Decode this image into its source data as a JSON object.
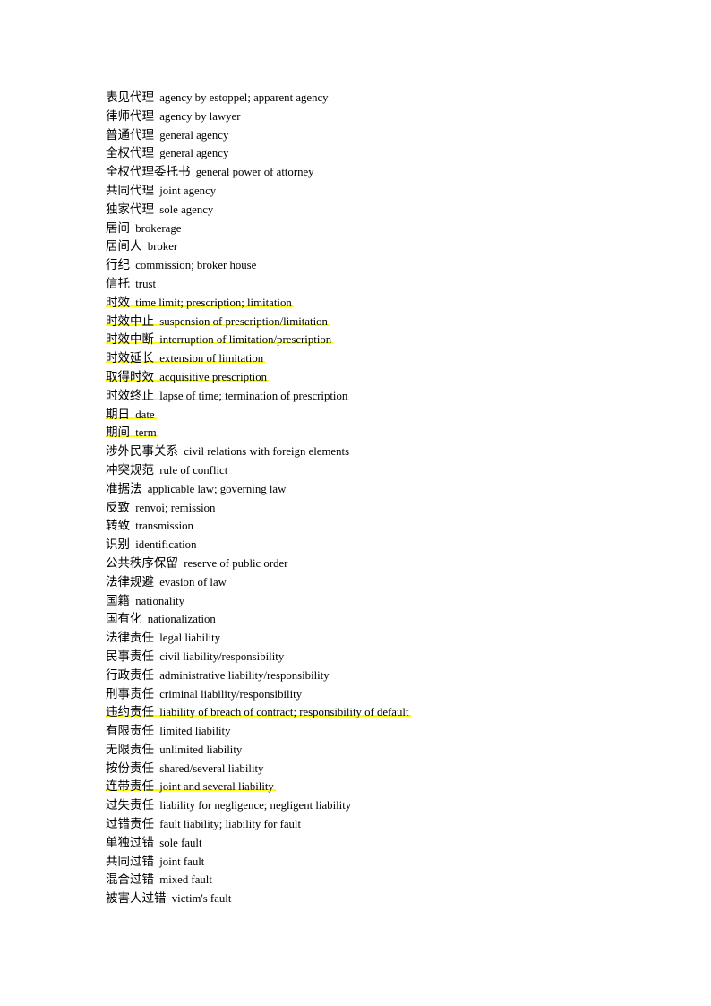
{
  "document": {
    "background_color": "#ffffff",
    "text_color": "#000000",
    "highlight_color": "#ffff00",
    "entries": [
      {
        "term": "表见代理",
        "definition": "agency by estoppel; apparent agency",
        "highlighted": false
      },
      {
        "term": "律师代理",
        "definition": "agency by lawyer",
        "highlighted": false
      },
      {
        "term": "普通代理",
        "definition": "general agency",
        "highlighted": false
      },
      {
        "term": "全权代理",
        "definition": "general agency",
        "highlighted": false
      },
      {
        "term": "全权代理委托书",
        "definition": "general power of attorney",
        "highlighted": false
      },
      {
        "term": "共同代理",
        "definition": "joint agency",
        "highlighted": false
      },
      {
        "term": "独家代理",
        "definition": "sole agency",
        "highlighted": false
      },
      {
        "term": "居间",
        "definition": "brokerage",
        "highlighted": false
      },
      {
        "term": "居间人",
        "definition": "broker",
        "highlighted": false
      },
      {
        "term": "行纪",
        "definition": "commission; broker house",
        "highlighted": false
      },
      {
        "term": "信托",
        "definition": "trust",
        "highlighted": false
      },
      {
        "term": "时效",
        "definition": "time limit; prescription; limitation",
        "highlighted": true
      },
      {
        "term": "时效中止",
        "definition": "suspension of prescription/limitation",
        "highlighted": true
      },
      {
        "term": "时效中断",
        "definition": "interruption of limitation/prescription",
        "highlighted": true
      },
      {
        "term": "时效延长",
        "definition": "extension of limitation",
        "highlighted": true
      },
      {
        "term": "取得时效",
        "definition": "acquisitive prescription",
        "highlighted": true
      },
      {
        "term": "时效终止",
        "definition": "lapse of time; termination of prescription",
        "highlighted": true
      },
      {
        "term": "期日",
        "definition": "date",
        "highlighted": true
      },
      {
        "term": "期间",
        "definition": "term",
        "highlighted": true
      },
      {
        "term": "涉外民事关系",
        "definition": "civil relations with foreign elements",
        "highlighted": false
      },
      {
        "term": "冲突规范",
        "definition": "rule of conflict",
        "highlighted": false
      },
      {
        "term": "准据法",
        "definition": "applicable law; governing law",
        "highlighted": false
      },
      {
        "term": "反致",
        "definition": "renvoi; remission",
        "highlighted": false
      },
      {
        "term": "转致",
        "definition": "transmission",
        "highlighted": false
      },
      {
        "term": "识别",
        "definition": "identification",
        "highlighted": false
      },
      {
        "term": "公共秩序保留",
        "definition": "reserve of public order",
        "highlighted": false
      },
      {
        "term": "法律规避",
        "definition": "evasion of law",
        "highlighted": false
      },
      {
        "term": "国籍",
        "definition": "nationality",
        "highlighted": false
      },
      {
        "term": "国有化",
        "definition": "nationalization",
        "highlighted": false
      },
      {
        "term": "法律责任",
        "definition": "legal liability",
        "highlighted": false
      },
      {
        "term": "民事责任",
        "definition": "civil liability/responsibility",
        "highlighted": false
      },
      {
        "term": "行政责任",
        "definition": "administrative liability/responsibility",
        "highlighted": false
      },
      {
        "term": "刑事责任",
        "definition": "criminal liability/responsibility",
        "highlighted": false
      },
      {
        "term": "违约责任",
        "definition": "liability of breach of contract; responsibility of default",
        "highlighted": true
      },
      {
        "term": "有限责任",
        "definition": "limited liability",
        "highlighted": false
      },
      {
        "term": "无限责任",
        "definition": "unlimited liability",
        "highlighted": false
      },
      {
        "term": "按份责任",
        "definition": "shared/several liability",
        "highlighted": false
      },
      {
        "term": "连带责任",
        "definition": "joint and several liability",
        "highlighted": true
      },
      {
        "term": "过失责任",
        "definition": "liability for negligence; negligent liability",
        "highlighted": false
      },
      {
        "term": "过错责任",
        "definition": "fault liability; liability for fault",
        "highlighted": false
      },
      {
        "term": "单独过错",
        "definition": "sole fault",
        "highlighted": false
      },
      {
        "term": "共同过错",
        "definition": "joint fault",
        "highlighted": false
      },
      {
        "term": "混合过错",
        "definition": "mixed fault",
        "highlighted": false
      },
      {
        "term": "被害人过错",
        "definition": "victim's fault",
        "highlighted": false
      }
    ]
  }
}
